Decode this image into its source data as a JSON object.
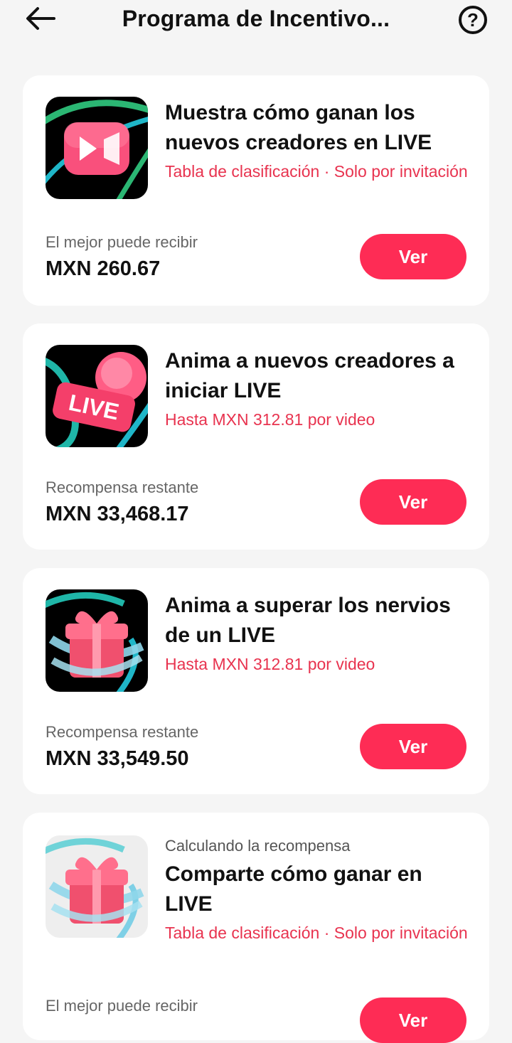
{
  "header": {
    "title": "Programa de Incentivo...",
    "back_icon": "arrow-left-icon",
    "help_icon": "question-circle-icon",
    "help_glyph": "?"
  },
  "cards": [
    {
      "title": "Muestra cómo ganan los nuevos creadores en LIVE",
      "subtitle": "Tabla de clasificación · Solo por invitación",
      "reward_label": "El mejor puede recibir",
      "reward_value": "MXN 260.67",
      "button_label": "Ver",
      "icon": "video-camera-icon"
    },
    {
      "title": "Anima a nuevos creadores a iniciar LIVE",
      "subtitle": "Hasta MXN 312.81 por video",
      "reward_label": "Recompensa restante",
      "reward_value": "MXN 33,468.17",
      "button_label": "Ver",
      "icon": "live-badge-icon",
      "icon_text": "LIVE"
    },
    {
      "title": "Anima a superar los nervios de un LIVE",
      "subtitle": "Hasta MXN 312.81 por video",
      "reward_label": "Recompensa restante",
      "reward_value": "MXN 33,549.50",
      "button_label": "Ver",
      "icon": "gift-box-icon"
    },
    {
      "pre_label": "Calculando la recompensa",
      "title": "Comparte cómo ganar en LIVE",
      "subtitle": "Tabla de clasificación · Solo por invitación",
      "reward_label": "El mejor puede recibir",
      "button_label": "Ver",
      "icon": "gift-box-icon"
    }
  ],
  "colors": {
    "accent": "#fe2c55",
    "subtitle": "#e8334f",
    "background": "#f5f5f5",
    "card": "#ffffff"
  }
}
